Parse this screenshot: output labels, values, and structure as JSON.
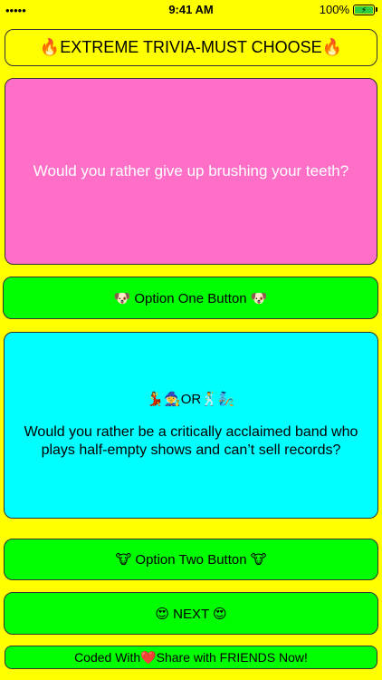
{
  "status_bar": {
    "left_text": "•••••",
    "time": "9:41 AM",
    "battery": "100%"
  },
  "header": {
    "title": "🔥EXTREME TRIVIA-MUST CHOOSE🔥"
  },
  "question_one": {
    "text": "Would you rather give up brushing your teeth?"
  },
  "option_one_button": {
    "label": "🐶 Option One Button 🐶"
  },
  "question_two": {
    "or_label": "💃🧙OR🕺🧞",
    "text": "Would you rather be a critically acclaimed band who plays half-empty shows and can’t sell records?"
  },
  "option_two_button": {
    "label": "🐮 Option Two Button 🐮"
  },
  "next_button": {
    "label": "😍 NEXT 😍"
  },
  "footer": {
    "label": "Coded With❤️Share with FRIENDS Now!"
  }
}
